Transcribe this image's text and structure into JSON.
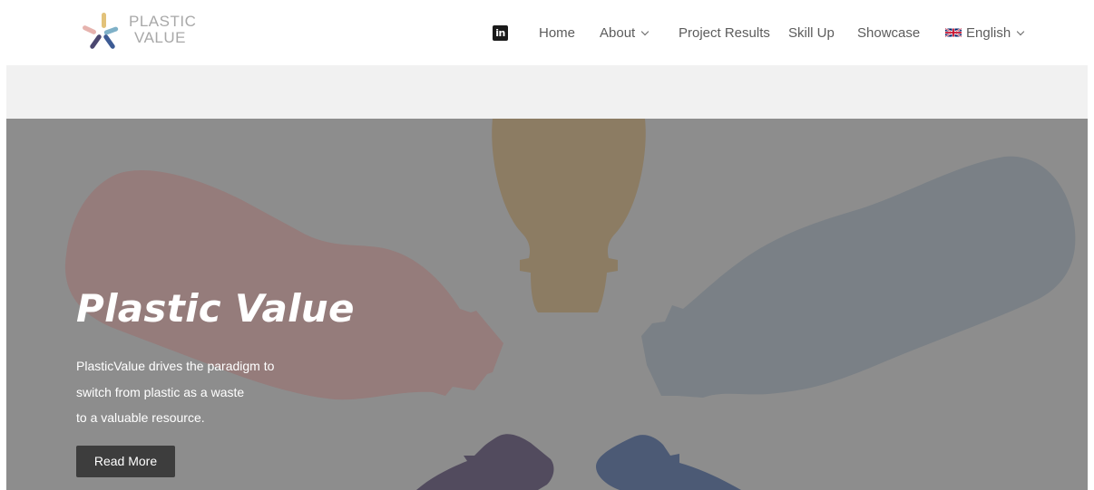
{
  "header": {
    "logo": {
      "line1": "PLASTIC",
      "line2": "VALUE"
    },
    "nav": {
      "linkedin_icon": "linkedin-icon",
      "linkedin_glyph": "in",
      "items": [
        {
          "label": "Home"
        },
        {
          "label": "About",
          "has_dropdown": true
        },
        {
          "label": "Project Results"
        },
        {
          "label": "Skill Up"
        },
        {
          "label": "Showcase"
        }
      ],
      "language": {
        "label": "English",
        "flag_icon": "uk-flag-icon",
        "has_dropdown": true
      }
    }
  },
  "hero": {
    "title": "Plastic Value",
    "description_lines": [
      "PlasticValue drives the paradigm to",
      "switch from plastic as a waste",
      "to a valuable resource."
    ],
    "button_label": "Read More"
  },
  "colors": {
    "hero_background": "#8d8d8d",
    "band_background": "#f1f1f1",
    "button_background": "#3d3d3d",
    "bottle_red": "#957c7b",
    "bottle_yellow": "#8c7c63",
    "bottle_blue_grey": "#7a8086",
    "bottle_purple": "#524b5e",
    "bottle_blue": "#4c5a75"
  }
}
